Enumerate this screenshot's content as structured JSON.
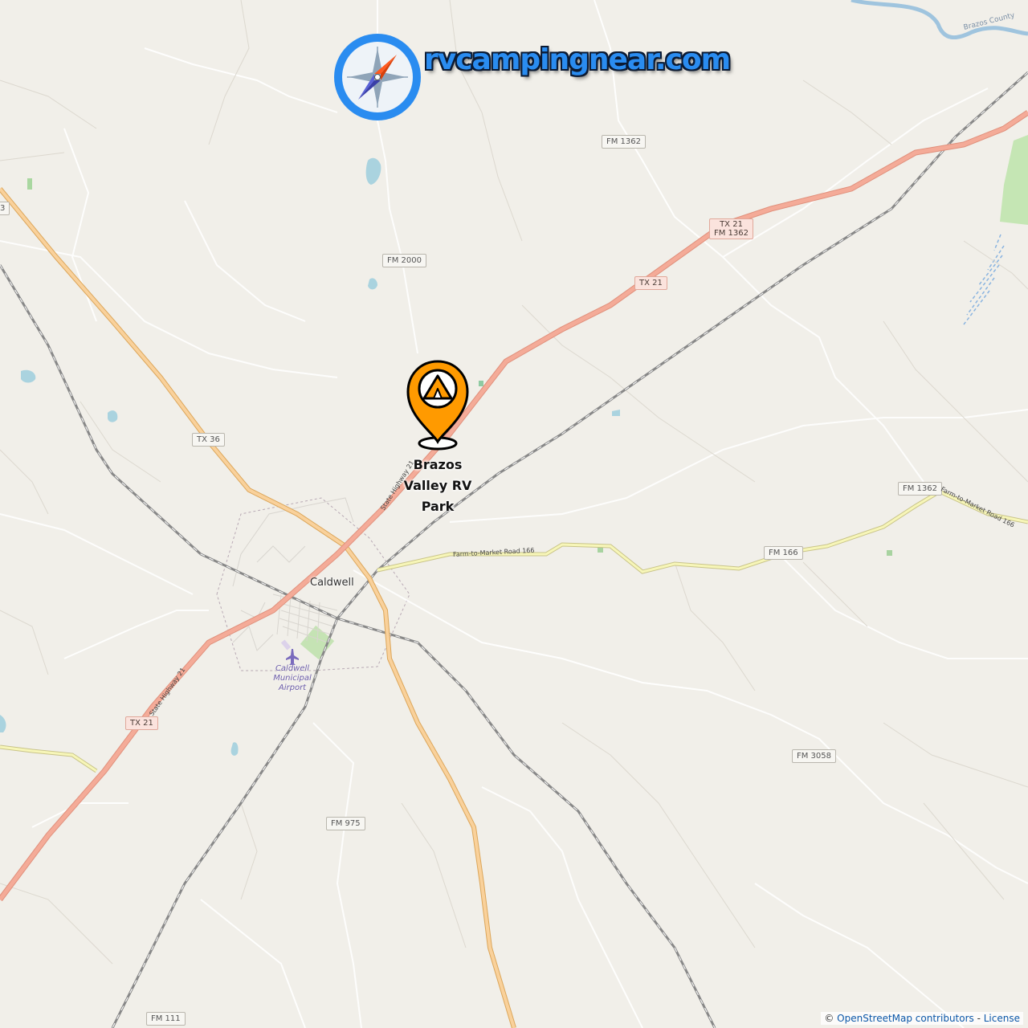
{
  "brand": {
    "site_name": "rvcampingnear.com",
    "accent_color": "#2a8cf0",
    "compass_icon": "compass-icon"
  },
  "poi": {
    "name_line1": "Brazos",
    "name_line2": "Valley RV",
    "name_line3": "Park",
    "marker_color": "#ff9a00",
    "icon": "tent-icon"
  },
  "places": {
    "town": "Caldwell",
    "airport_line1": "Caldwell",
    "airport_line2": "Municipal",
    "airport_line3": "Airport",
    "county": "Brazos County"
  },
  "road_labels": {
    "fm1362_top": "FM 1362",
    "tx21_fm1362_a": "TX 21",
    "tx21_fm1362_b": "FM 1362",
    "tx21_ne": "TX 21",
    "fm2000": "FM 2000",
    "tx36": "TX 36",
    "fm1362_east": "FM 1362",
    "fm166": "FM 166",
    "tx21_sw": "TX 21",
    "fm3058": "FM 3058",
    "fm975": "FM 975",
    "fm111": "FM 111",
    "partial_left": "3",
    "sh21_a": "State Highway 21",
    "sh21_b": "State Highway 21",
    "farm166_a": "Farm-to-Market Road 166",
    "farm166_b": "Farm-to-Market Road 166"
  },
  "attribution": {
    "prefix": "© ",
    "osm": "OpenStreetMap contributors",
    "sep": " - ",
    "license": "License"
  }
}
